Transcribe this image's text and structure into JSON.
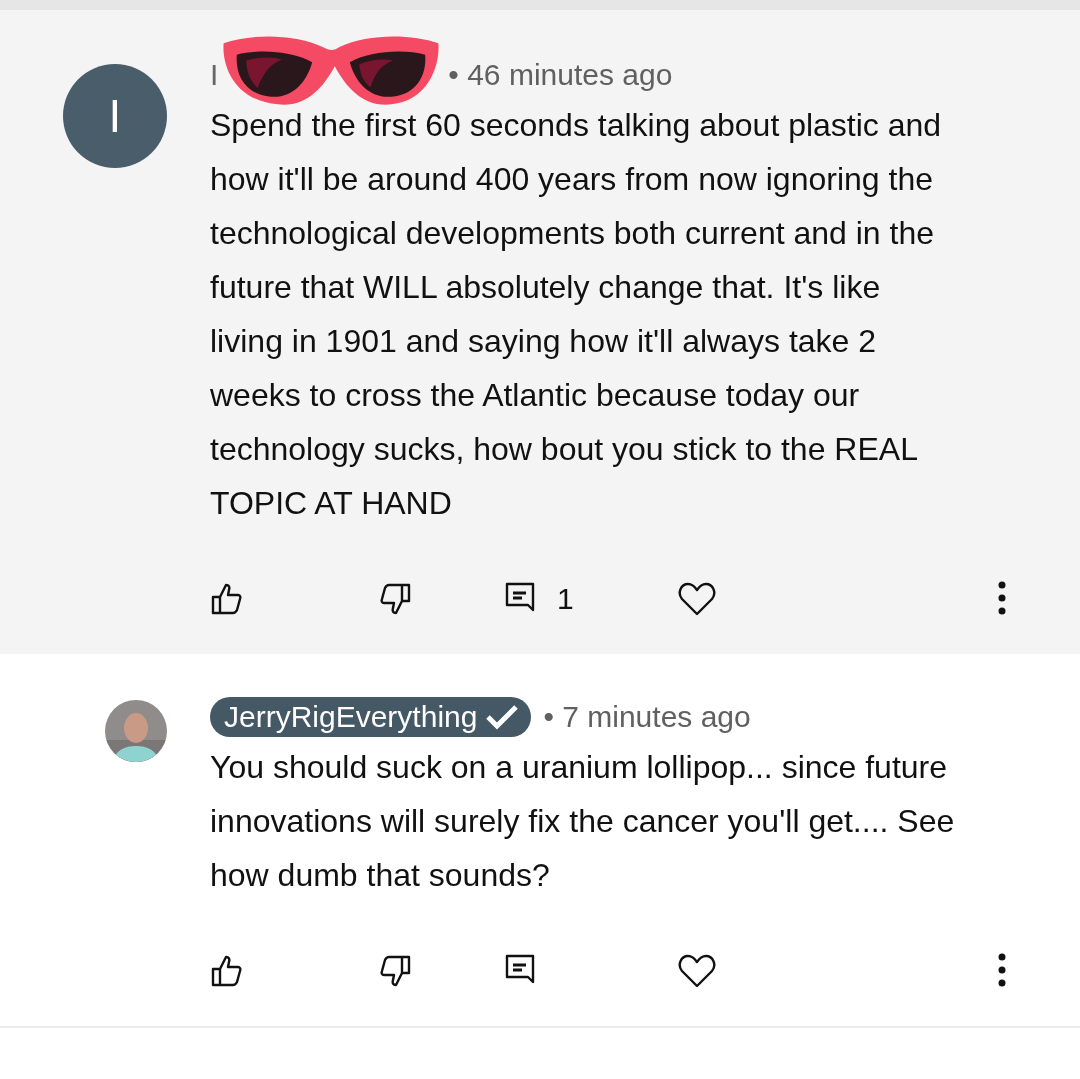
{
  "comments": [
    {
      "highlighted": true,
      "avatar": {
        "kind": "letter",
        "letter": "I"
      },
      "author": "I",
      "creator": false,
      "sticker": true,
      "time": "• 46 minutes ago",
      "text": "Spend the first 60 seconds talking about plastic and how it'll be around 400 years from now ignoring the technological developments both current and in the future that WILL absolutely change that. It's like living in 1901 and saying how it'll always take 2 weeks to cross the Atlantic because today our technology sucks, how bout you stick to the REAL TOPIC AT HAND",
      "reply_count": "1"
    },
    {
      "highlighted": false,
      "author": "JerryRigEverything",
      "creator": true,
      "sticker": false,
      "time": "• 7 minutes ago",
      "text": "You should suck on a uranium lollipop... since future innovations will surely fix the cancer you'll get.... See how dumb that sounds?"
    }
  ]
}
